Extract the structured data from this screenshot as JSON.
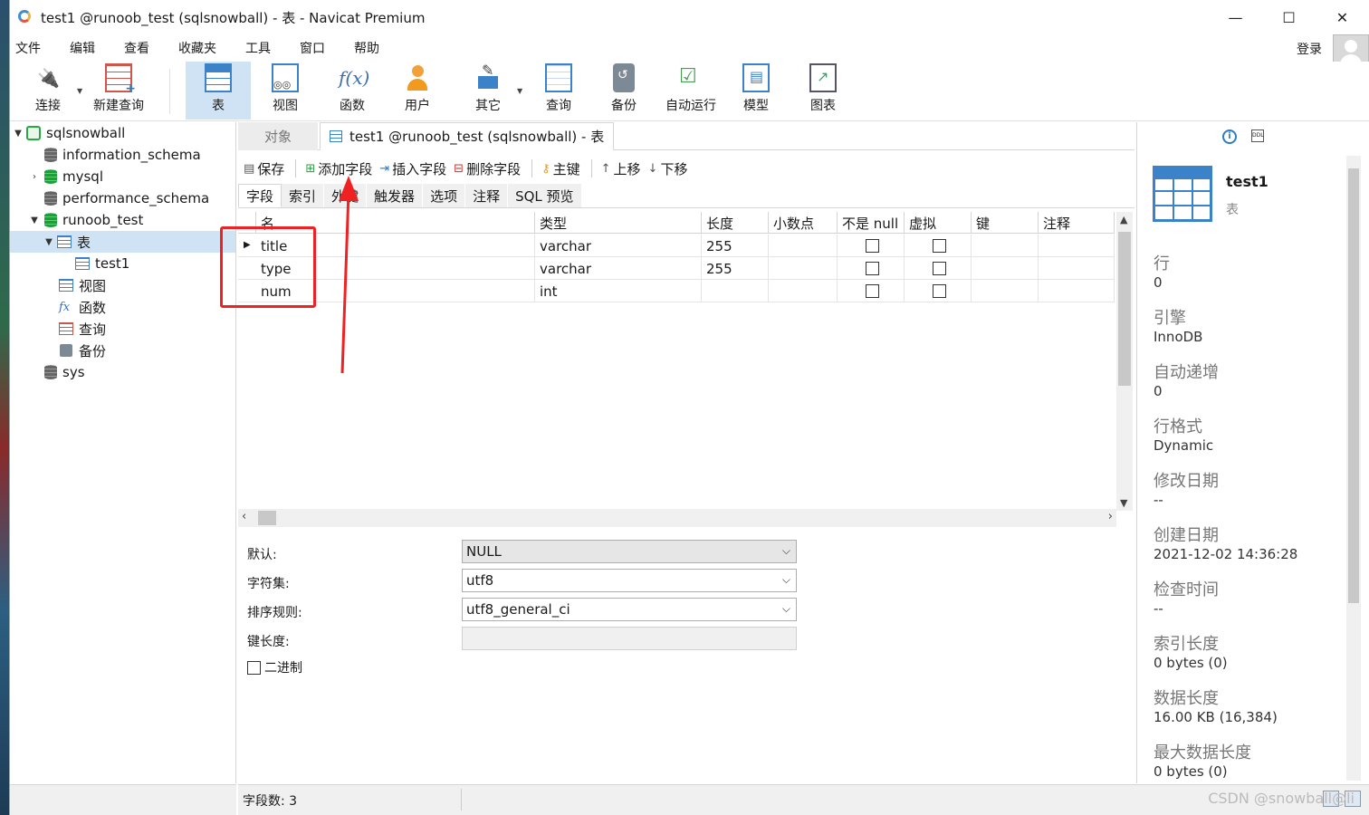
{
  "window": {
    "title": "test1 @runoob_test (sqlsnowball) - 表 - Navicat Premium",
    "controls": {
      "minimize": "—",
      "maximize": "☐",
      "close": "✕"
    }
  },
  "menu": {
    "items": [
      "文件",
      "编辑",
      "查看",
      "收藏夹",
      "工具",
      "窗口",
      "帮助"
    ],
    "login": "登录"
  },
  "toolbar": {
    "buttons": [
      {
        "label": "连接",
        "icon": "plug-icon"
      },
      {
        "label": "新建查询",
        "icon": "new-query-icon"
      },
      {
        "label": "表",
        "icon": "table-icon",
        "active": true
      },
      {
        "label": "视图",
        "icon": "view-icon"
      },
      {
        "label": "函数",
        "icon": "function-icon"
      },
      {
        "label": "用户",
        "icon": "user-icon"
      },
      {
        "label": "其它",
        "icon": "tools-icon"
      },
      {
        "label": "查询",
        "icon": "query-icon"
      },
      {
        "label": "备份",
        "icon": "backup-icon"
      },
      {
        "label": "自动运行",
        "icon": "auto-run-icon"
      },
      {
        "label": "模型",
        "icon": "model-icon"
      },
      {
        "label": "图表",
        "icon": "chart-icon"
      }
    ]
  },
  "navigator": {
    "connection": "sqlsnowball",
    "databases": [
      "information_schema",
      "mysql",
      "performance_schema",
      "runoob_test",
      "sys"
    ],
    "runoob_children": {
      "tables": "表",
      "table1": "test1",
      "views": "视图",
      "functions": "函数",
      "queries": "查询",
      "backups": "备份"
    },
    "fx_glyph": "fx"
  },
  "tabs": {
    "objects": "对象",
    "active": "test1 @runoob_test (sqlsnowball) - 表"
  },
  "design_toolbar": {
    "save": "保存",
    "add_field": "添加字段",
    "insert_field": "插入字段",
    "delete_field": "删除字段",
    "primary_key": "主键",
    "move_up": "上移",
    "move_down": "下移"
  },
  "subtabs": [
    "字段",
    "索引",
    "外键",
    "触发器",
    "选项",
    "注释",
    "SQL 预览"
  ],
  "grid": {
    "columns": [
      "名",
      "类型",
      "长度",
      "小数点",
      "不是 null",
      "虚拟",
      "键",
      "注释"
    ],
    "rows": [
      {
        "name": "title",
        "type": "varchar",
        "length": "255",
        "decimals": "",
        "not_null": false,
        "virtual": false,
        "key": "",
        "comment": ""
      },
      {
        "name": "type",
        "type": "varchar",
        "length": "255",
        "decimals": "",
        "not_null": false,
        "virtual": false,
        "key": "",
        "comment": ""
      },
      {
        "name": "num",
        "type": "int",
        "length": "",
        "decimals": "",
        "not_null": false,
        "virtual": false,
        "key": "",
        "comment": ""
      }
    ]
  },
  "properties": {
    "default_label": "默认:",
    "default_value": "NULL",
    "charset_label": "字符集:",
    "charset_value": "utf8",
    "collation_label": "排序规则:",
    "collation_value": "utf8_general_ci",
    "key_length_label": "键长度:",
    "key_length_value": "",
    "binary_label": "二进制"
  },
  "status": {
    "field_count": "字段数: 3"
  },
  "info_panel": {
    "name": "test1",
    "kind": "表",
    "fields": [
      {
        "k": "行",
        "v": "0"
      },
      {
        "k": "引擎",
        "v": "InnoDB"
      },
      {
        "k": "自动递增",
        "v": "0"
      },
      {
        "k": "行格式",
        "v": "Dynamic"
      },
      {
        "k": "修改日期",
        "v": "--"
      },
      {
        "k": "创建日期",
        "v": "2021-12-02 14:36:28"
      },
      {
        "k": "检查时间",
        "v": "--"
      },
      {
        "k": "索引长度",
        "v": "0 bytes (0)"
      },
      {
        "k": "数据长度",
        "v": "16.00 KB (16,384)"
      },
      {
        "k": "最大数据长度",
        "v": "0 bytes (0)"
      }
    ],
    "info_icon": "i",
    "ddl_icon": "DDL"
  },
  "watermark": "CSDN @snowball@li",
  "colors": {
    "selection": "#cfe3f4",
    "accent": "#3c82c8",
    "annotation": "#ee2222"
  }
}
